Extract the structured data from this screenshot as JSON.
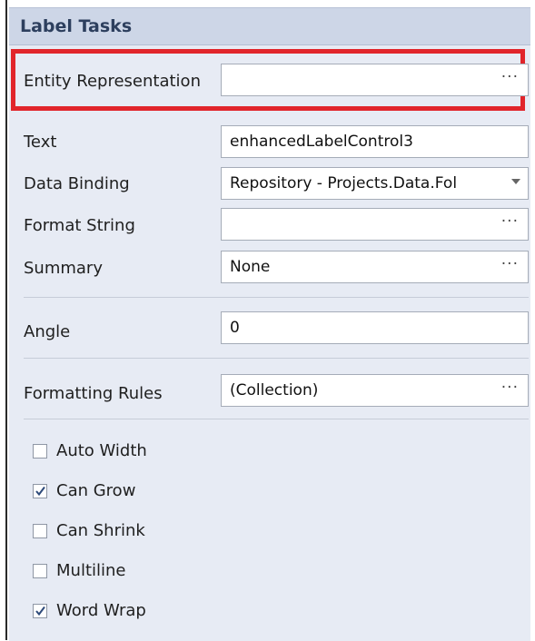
{
  "panel": {
    "title": "Label Tasks"
  },
  "entity_representation": {
    "label": "Entity Representation",
    "value": "",
    "button": "···"
  },
  "properties": [
    {
      "label": "Text",
      "value": "enhancedLabelControl3",
      "button": ""
    },
    {
      "label": "Data Binding",
      "value": "Repository - Projects.Data.Fol",
      "button": "dropdown"
    },
    {
      "label": "Format String",
      "value": "",
      "button": "···"
    },
    {
      "label": "Summary",
      "value": "None",
      "button": "···"
    }
  ],
  "angle": {
    "label": "Angle",
    "value": "0"
  },
  "formatting_rules": {
    "label": "Formatting Rules",
    "value": "(Collection)",
    "button": "···"
  },
  "checkboxes": [
    {
      "label": "Auto Width",
      "checked": false
    },
    {
      "label": "Can Grow",
      "checked": true
    },
    {
      "label": "Can Shrink",
      "checked": false
    },
    {
      "label": "Multiline",
      "checked": false
    },
    {
      "label": "Word Wrap",
      "checked": true
    }
  ],
  "colors": {
    "highlight": "#e1252b",
    "header_bg": "#cdd6e7",
    "panel_bg": "#e7ebf4"
  }
}
